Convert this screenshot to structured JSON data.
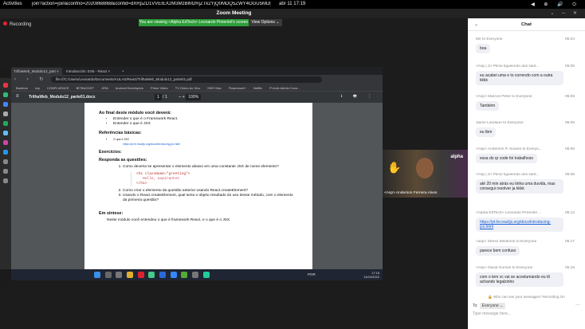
{
  "topbar": {
    "activities": "Activities",
    "window_title": "join?action=join&confno=2020868868&confid=dXRpZD1VVEIEX2M3MzBlM2RjZTk2YjQ0MDQ5ZWY4OGU5MDljZ...",
    "clock": "abr 11  17:19",
    "tray": "◀ ⊕ 🔊 ⏻"
  },
  "zoom": {
    "title": "Zoom Meeting",
    "controls": "⌄ ─ ✕",
    "recording": "Recording",
    "banner": "You are viewing <Alpha EdTech> Leonardo Pimentel's screen",
    "view_options": "View Options ⌄"
  },
  "browser": {
    "tab1": "TrilhaWeb_Modulo12_part ×",
    "tab2": "Introducción: ES6 - React ×",
    "tab_add": "+",
    "nav": "‹ › ↻ ⌂",
    "url": "file:///C:/Users/Leonardo/Documents/AULAS/React/TrilhaWeb_Modulo12_parte01.pdf",
    "bookmarks": [
      "Bamboo",
      "rep",
      "CONFLUENCE",
      "BITBUCKET",
      "JIRA",
      "Android Developers",
      "Prime Video",
      "TV Globo Ao Vivo",
      "HBO Max",
      "Paramount+",
      "Netflix",
      "Pi-hole Admin Cons..."
    ]
  },
  "pdf": {
    "menu": "≡",
    "filename": "TrilhaWeb_Modulo12_parte01.docx",
    "page_current": "1",
    "page_total": "/ 1",
    "zoom": "100%",
    "zoom_controls": "─   +",
    "actions": "⭳ 🖶 ⋮"
  },
  "doc": {
    "heading1": "Ao final deste módulo você deverá:",
    "goals": [
      "Entender o que é o Framework React.",
      "Entender o que é JSX"
    ],
    "heading2": "Referências básicas:",
    "ref": "O que é JSX",
    "ref_link": "https://pt-br.reactjs.org/docs/introducing-jsx.html",
    "heading3": "Exercícios:",
    "heading4": "Responda as questões:",
    "q1": "Como deveria se apresentar o elemento abaixo em uma constante JSX de nome elemento?",
    "code1": "<h1 className=\"greeting\">",
    "code2": "Hello, aspirantes",
    "code3": "</h1>",
    "q2": "Como criar o elemento da questão anterior usando React.createElement?",
    "q3": "Usando o React.createElement, qual seria o objeto resultado do uso desse método, com o elemento da primeira questão?",
    "heading5": "Em síntese:",
    "summary": "Neste módulo você entendeu o que é framework React, e o que é o JSX."
  },
  "taskbar": {
    "lang": "POR",
    "time": "17:18",
    "date": "11/04/2022"
  },
  "video": {
    "brand": "alpha",
    "name": "<Asp> Anderson Ferreira Alves"
  },
  "chat": {
    "title": "Chat",
    "collapse": "⌄",
    "messages": [
      {
        "from": "Me to Everyone",
        "time": "05:04",
        "text": "boa"
      },
      {
        "from": "<Asp | 2> Plinio figueiredo dos sant...",
        "time": "05:05",
        "text": "eu acabei uma e to correndo com a outra kkkk"
      },
      {
        "from": "<Asp> Marcos Peter to Everyone",
        "time": "05:05",
        "text": "Também"
      },
      {
        "from": "Jaime Landauri to Everyone",
        "time": "05:05",
        "text": "eu tbm"
      },
      {
        "from": "<Asp> Anderson P. Soares to Everyo...",
        "time": "05:06",
        "text": "essa do qr code foi trabalhoso"
      },
      {
        "from": "<Asp | 2> Plinio figueiredo dos sant...",
        "time": "05:06",
        "text": "até 20 min atrás eu tinha uma duvida, mas consegui resolver ja kkkk"
      },
      {
        "from": "<Alpha EdTech> Leonardo Pimentel ...",
        "time": "05:12",
        "text": "https://pt-br.reactjs.org/docs/introducing-jsx.html"
      },
      {
        "from": "<asp> Stenio Medeiros to Everyone",
        "time": "05:17",
        "text": "parece bem confuso"
      },
      {
        "from": "<Asp> David Gomes to Everyone",
        "time": "05:18",
        "text": "com o tem vc vai se acostumando eu tô achando legalzinho"
      }
    ],
    "who_can_see": "🔒 Who can see your messages? Recording On",
    "to_label": "To:",
    "to_value": "Everyone ⌄",
    "input_placeholder": "Type message here...",
    "more": "···"
  }
}
